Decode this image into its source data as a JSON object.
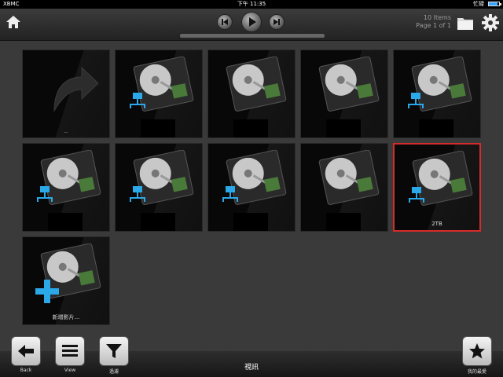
{
  "status": {
    "carrier": "XBMC",
    "time": "下午 11:35",
    "battery_label": "忙碌",
    "battery_level": 0.85
  },
  "header": {
    "items_count": "10 Items",
    "page": "Page 1 of 1"
  },
  "grid": {
    "items": [
      {
        "label": "..",
        "type": "parent"
      },
      {
        "label": "",
        "type": "network-drive"
      },
      {
        "label": "",
        "type": "drive"
      },
      {
        "label": "",
        "type": "drive"
      },
      {
        "label": "",
        "type": "network-drive"
      },
      {
        "label": "",
        "type": "network-drive"
      },
      {
        "label": "",
        "type": "network-drive"
      },
      {
        "label": "",
        "type": "network-drive"
      },
      {
        "label": "",
        "type": "drive"
      },
      {
        "label": "2TB",
        "type": "network-drive",
        "selected": true
      },
      {
        "label": "新增影片...",
        "type": "add-source"
      }
    ]
  },
  "footer": {
    "back_label": "Back",
    "view_label": "View",
    "filter_label": "過濾",
    "section_title": "視訊",
    "favourites_label": "我的最愛"
  },
  "colors": {
    "selection": "#d82a2a",
    "accent_blue": "#2aa8e8"
  }
}
